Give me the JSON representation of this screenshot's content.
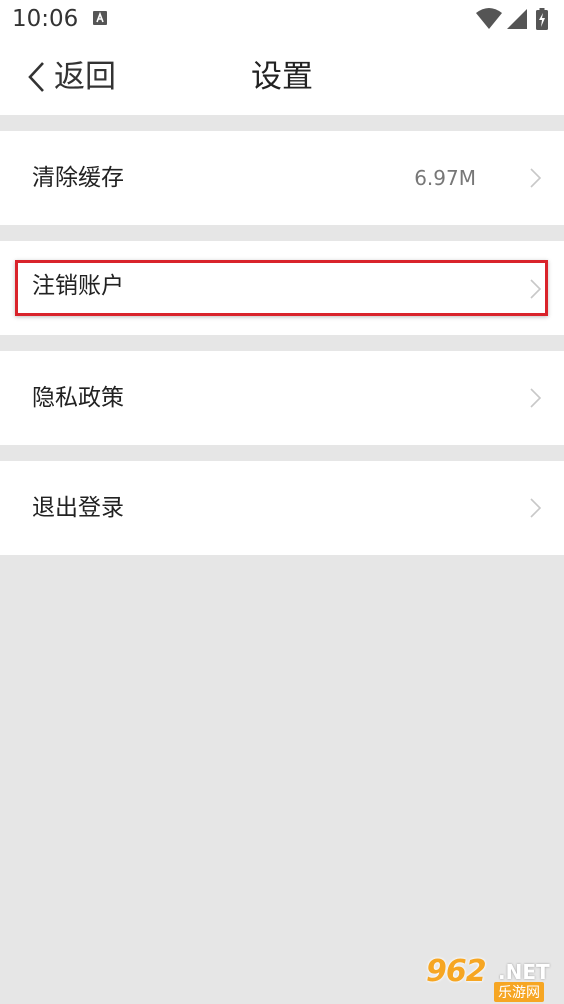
{
  "status_bar": {
    "time": "10:06",
    "notification_icon": "a-box-icon",
    "icons": [
      "wifi-icon",
      "signal-icon",
      "battery-charging-icon"
    ]
  },
  "header": {
    "back_label": "返回",
    "title": "设置"
  },
  "settings": {
    "items": [
      {
        "label": "清除缓存",
        "value": "6.97M"
      },
      {
        "label": "注销账户",
        "value": ""
      },
      {
        "label": "隐私政策",
        "value": ""
      },
      {
        "label": "退出登录",
        "value": ""
      }
    ]
  },
  "watermark": {
    "brand": "962",
    "suffix": ".NET",
    "tagline": "乐游网"
  },
  "colors": {
    "background": "#e6e6e6",
    "surface": "#ffffff",
    "highlight": "#d9232b",
    "watermark": "#f6a623"
  }
}
